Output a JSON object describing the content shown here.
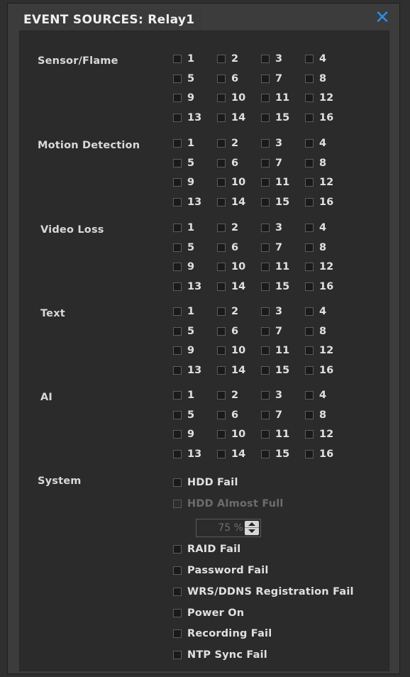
{
  "dialog": {
    "title": "EVENT SOURCES: Relay1",
    "close_icon": "close-icon",
    "accent": "#2a8de6"
  },
  "sections": [
    {
      "label": "Sensor/Flame",
      "channels": [
        "1",
        "2",
        "3",
        "4",
        "5",
        "6",
        "7",
        "8",
        "9",
        "10",
        "11",
        "12",
        "13",
        "14",
        "15",
        "16"
      ]
    },
    {
      "label": "Motion Detection",
      "channels": [
        "1",
        "2",
        "3",
        "4",
        "5",
        "6",
        "7",
        "8",
        "9",
        "10",
        "11",
        "12",
        "13",
        "14",
        "15",
        "16"
      ]
    },
    {
      "label": "Video Loss",
      "channels": [
        "1",
        "2",
        "3",
        "4",
        "5",
        "6",
        "7",
        "8",
        "9",
        "10",
        "11",
        "12",
        "13",
        "14",
        "15",
        "16"
      ]
    },
    {
      "label": "Text",
      "channels": [
        "1",
        "2",
        "3",
        "4",
        "5",
        "6",
        "7",
        "8",
        "9",
        "10",
        "11",
        "12",
        "13",
        "14",
        "15",
        "16"
      ]
    },
    {
      "label": "AI",
      "channels": [
        "1",
        "2",
        "3",
        "4",
        "5",
        "6",
        "7",
        "8",
        "9",
        "10",
        "11",
        "12",
        "13",
        "14",
        "15",
        "16"
      ]
    }
  ],
  "system": {
    "label": "System",
    "items": [
      {
        "label": "HDD Fail",
        "checked": false,
        "disabled": false
      },
      {
        "label": "HDD Almost Full",
        "checked": false,
        "disabled": true
      },
      {
        "label": "RAID Fail",
        "checked": false,
        "disabled": false
      },
      {
        "label": "Password Fail",
        "checked": false,
        "disabled": false
      },
      {
        "label": "WRS/DDNS Registration Fail",
        "checked": false,
        "disabled": false
      },
      {
        "label": "Power On",
        "checked": false,
        "disabled": false
      },
      {
        "label": "Recording Fail",
        "checked": false,
        "disabled": false
      },
      {
        "label": "NTP Sync Fail",
        "checked": false,
        "disabled": false
      }
    ],
    "hdd_threshold": "75 %"
  }
}
